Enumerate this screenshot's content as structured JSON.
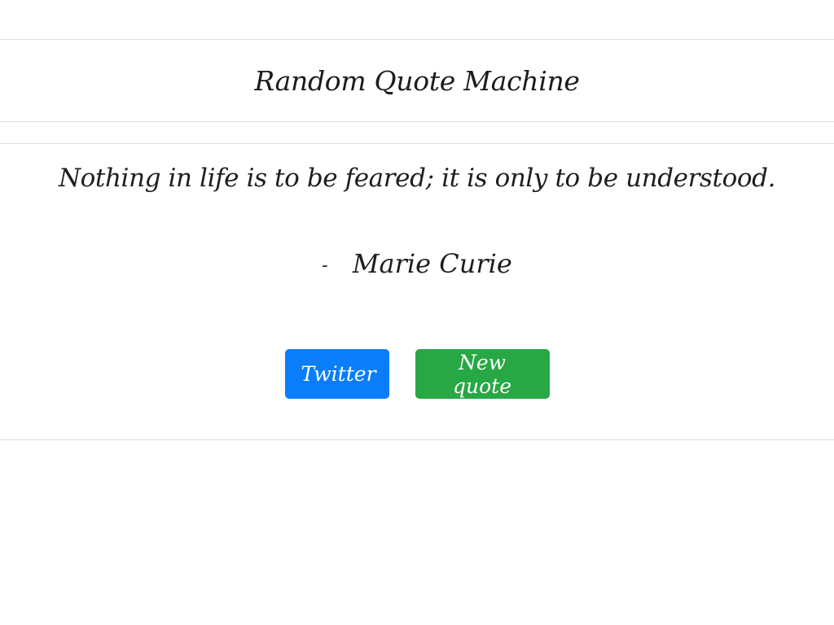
{
  "header": {
    "title": "Random Quote Machine"
  },
  "quote": {
    "text": "Nothing in life is to be feared; it is only to be understood.",
    "dash": "-",
    "author": "Marie Curie"
  },
  "actions": {
    "twitter_label": "Twitter",
    "new_quote_label": "New quote"
  },
  "colors": {
    "twitter_button": "#0a7dfa",
    "new_quote_button": "#27a844",
    "divider": "#dedede"
  }
}
